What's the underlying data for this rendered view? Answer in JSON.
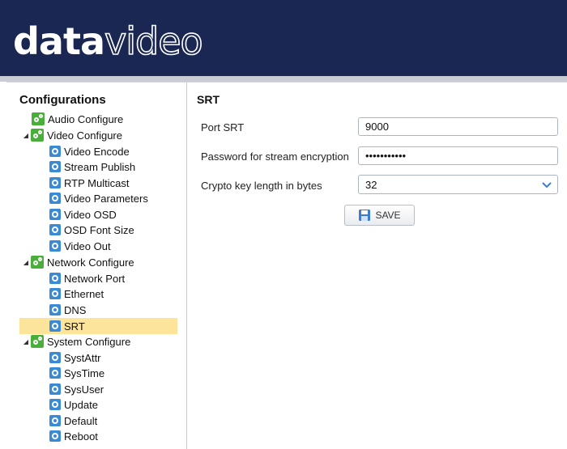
{
  "header": {
    "logo_bold": "data",
    "logo_light": "video"
  },
  "sidebar": {
    "title": "Configurations",
    "items": [
      {
        "label": "Audio Configure"
      },
      {
        "label": "Video Configure"
      },
      {
        "label": "Video Encode"
      },
      {
        "label": "Stream Publish"
      },
      {
        "label": "RTP Multicast"
      },
      {
        "label": "Video Parameters"
      },
      {
        "label": "Video OSD"
      },
      {
        "label": "OSD Font Size"
      },
      {
        "label": "Video Out"
      },
      {
        "label": "Network Configure"
      },
      {
        "label": "Network Port"
      },
      {
        "label": "Ethernet"
      },
      {
        "label": "DNS"
      },
      {
        "label": "SRT"
      },
      {
        "label": "System Configure"
      },
      {
        "label": "SystAttr"
      },
      {
        "label": "SysTime"
      },
      {
        "label": "SysUser"
      },
      {
        "label": "Update"
      },
      {
        "label": "Default"
      },
      {
        "label": "Reboot"
      }
    ],
    "selected": "SRT",
    "selected_color": "#fde49b"
  },
  "main": {
    "title": "SRT",
    "fields": {
      "port_label": "Port SRT",
      "port_value": "9000",
      "password_label": "Password for stream encryption",
      "password_value": "mypassword1",
      "crypto_label": "Crypto key length in bytes",
      "crypto_value": "32"
    },
    "save_label": "SAVE"
  },
  "colors": {
    "header_bg": "#1b2753",
    "group_icon": "#4aae3a",
    "item_icon": "#3a8ad6"
  }
}
